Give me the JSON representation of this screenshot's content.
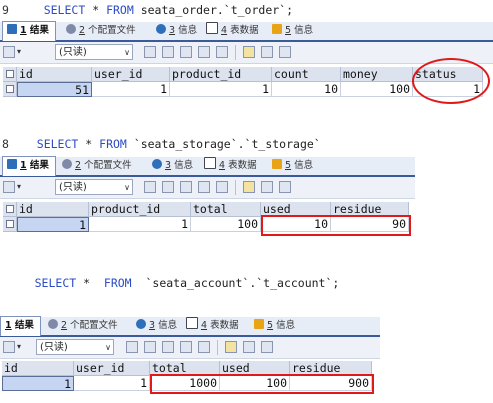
{
  "block1": {
    "line_number": "9",
    "kw_select": "SELECT",
    "star": "*",
    "kw_from": "FROM",
    "table": "seata_order.`t_order`;",
    "tabs": [
      {
        "num": "1",
        "label": " 结果",
        "icon": "results-grid-icon"
      },
      {
        "num": "2",
        "label": " 个配置文件",
        "icon": "profile-icon"
      },
      {
        "num": "3",
        "label": " 信息",
        "icon": "info-icon"
      },
      {
        "num": "4",
        "label": " 表数据",
        "icon": "table-data-icon"
      },
      {
        "num": "5",
        "label": " 信息",
        "icon": "info-chart-icon"
      }
    ],
    "readonly": "(只读)",
    "columns": [
      "id",
      "user_id",
      "product_id",
      "count",
      "money",
      "status"
    ],
    "row": [
      "51",
      "1",
      "1",
      "10",
      "100",
      "1"
    ]
  },
  "block2": {
    "line_number": "8",
    "kw_select": "SELECT",
    "star": "*",
    "kw_from": "FROM",
    "table": "`seata_storage`.`t_storage`",
    "tabs": [
      {
        "num": "1",
        "label": " 结果",
        "icon": "results-grid-icon"
      },
      {
        "num": "2",
        "label": " 个配置文件",
        "icon": "profile-icon"
      },
      {
        "num": "3",
        "label": " 信息",
        "icon": "info-icon"
      },
      {
        "num": "4",
        "label": " 表数据",
        "icon": "table-data-icon"
      },
      {
        "num": "5",
        "label": " 信息",
        "icon": "info-chart-icon"
      }
    ],
    "readonly": "(只读)",
    "columns": [
      "id",
      "product_id",
      "total",
      "used",
      "residue"
    ],
    "row": [
      "1",
      "1",
      "100",
      "10",
      "90"
    ]
  },
  "block3": {
    "kw_select": "SELECT",
    "star": "*",
    "kw_from": "FROM",
    "table": "`seata_account`.`t_account`;",
    "tabs": [
      {
        "num": "1",
        "label": " 结果",
        "icon": "results-grid-icon"
      },
      {
        "num": "2",
        "label": " 个配置文件",
        "icon": "profile-icon"
      },
      {
        "num": "3",
        "label": " 信息",
        "icon": "info-icon"
      },
      {
        "num": "4",
        "label": " 表数据",
        "icon": "table-data-icon"
      },
      {
        "num": "5",
        "label": " 信息",
        "icon": "info-chart-icon"
      }
    ],
    "readonly": "(只读)",
    "columns": [
      "id",
      "user_id",
      "total",
      "used",
      "residue"
    ],
    "row": [
      "1",
      "1",
      "1000",
      "100",
      "900"
    ]
  },
  "colors": {
    "highlight": "#e0191b",
    "keyword": "#2b4cc4",
    "tab_bar": "#e7edf7",
    "header_cell": "#dde3ee",
    "selected_cell": "#c6d6f2"
  }
}
